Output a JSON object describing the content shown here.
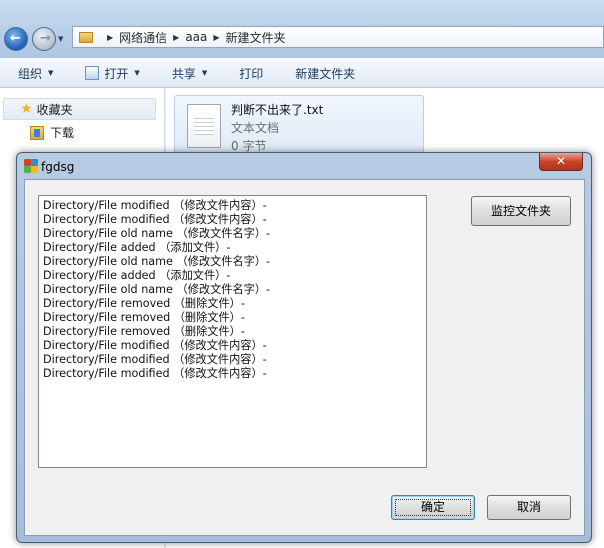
{
  "explorer": {
    "breadcrumb": [
      "网络通信",
      "aaa",
      "新建文件夹"
    ],
    "toolbar": {
      "organize": "组织",
      "open": "打开",
      "share": "共享",
      "print": "打印",
      "new_folder": "新建文件夹"
    },
    "nav": {
      "favorites": "收藏夹",
      "downloads": "下载"
    },
    "file": {
      "name": "判断不出来了.txt",
      "type": "文本文档",
      "size": "0 字节"
    }
  },
  "dialog": {
    "title": "fgdsg",
    "close_glyph": "✕",
    "monitor_button": "监控文件夹",
    "ok_button": "确定",
    "cancel_button": "取消",
    "log": [
      "Directory/File modified （修改文件内容）-",
      "Directory/File modified （修改文件内容）-",
      "Directory/File old name （修改文件名字）-",
      "Directory/File added （添加文件）-",
      "Directory/File old name （修改文件名字）-",
      "Directory/File added （添加文件）-",
      "Directory/File old name （修改文件名字）-",
      "Directory/File removed （删除文件）-",
      "Directory/File removed （删除文件）-",
      "Directory/File removed （删除文件）-",
      "Directory/File modified （修改文件内容）-",
      "Directory/File modified （修改文件内容）-",
      "Directory/File modified （修改文件内容）-"
    ]
  },
  "icons": {
    "back": "back-arrow-icon",
    "forward": "forward-arrow-icon",
    "favorites": "star-icon",
    "downloads": "download-folder-icon",
    "file": "text-document-icon",
    "app": "app-icon"
  }
}
